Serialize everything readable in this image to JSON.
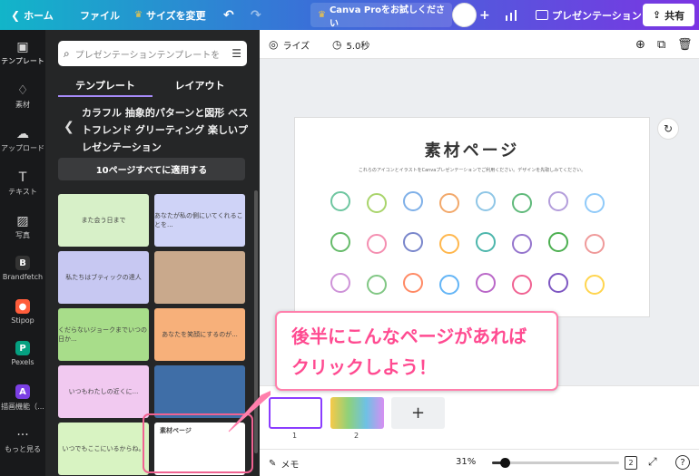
{
  "topbar": {
    "home_label": "ホーム",
    "file_label": "ファイル",
    "resize_label": "サイズを変更",
    "promo_label": "Canva Proをお試しください",
    "present_label": "プレゼンテーション",
    "share_label": "共有"
  },
  "rail": [
    {
      "label": "テンプレート",
      "icon": "layout-icon"
    },
    {
      "label": "素材",
      "icon": "elements-icon"
    },
    {
      "label": "アップロード",
      "icon": "cloud-upload-icon"
    },
    {
      "label": "テキスト",
      "icon": "text-icon"
    },
    {
      "label": "写真",
      "icon": "photo-icon"
    },
    {
      "label": "Brandfetch",
      "icon": "brandfetch-icon"
    },
    {
      "label": "Stipop",
      "icon": "stipop-icon"
    },
    {
      "label": "Pexels",
      "icon": "pexels-icon"
    },
    {
      "label": "描画機能（...",
      "icon": "draw-icon"
    },
    {
      "label": "もっと見る",
      "icon": "more-icon"
    }
  ],
  "panel": {
    "search_placeholder": "プレゼンテーションテンプレートを",
    "tabs": [
      "テンプレート",
      "レイアウト"
    ],
    "template_title": "カラフル 抽象的パターンと図形 ベストフレンド グリーティング 楽しいプレゼンテーション",
    "apply_all_label": "10ページすべてに適用する",
    "thumbnails": [
      {
        "text": "また会う日まで",
        "bg": "#d7f0c8"
      },
      {
        "text": "あなたが私の側にいてくれることを...",
        "bg": "#cfd3f7"
      },
      {
        "text": "私たちはブティックの達人",
        "bg": "#c7c8f2"
      },
      {
        "text": "",
        "bg": "#c9a98c"
      },
      {
        "text": "くだらないジョークまでいつの日か...",
        "bg": "#a8dd8a"
      },
      {
        "text": "あなたを笑顔にするのが...",
        "bg": "#f7b07a"
      },
      {
        "text": "いつもわたしの近くに...",
        "bg": "#f1c9f0"
      },
      {
        "text": "",
        "bg": "#3f6ea7"
      },
      {
        "text": "いつでもここにいるからね。",
        "bg": "#d8f3c2"
      },
      {
        "text": "素材ページ",
        "bg": "#ffffff"
      }
    ]
  },
  "editor": {
    "toolbar": {
      "animate_label": "ライズ",
      "duration_label": "5.0秒"
    },
    "slide": {
      "title": "素材ページ",
      "subtitle": "これらのアイコンとイラストをCanvaプレゼンテーションでご利用ください。デザインを先取しみてください。"
    },
    "pages": [
      {
        "number": "1"
      },
      {
        "number": "2"
      }
    ],
    "add_page_label": "+",
    "notes_label": "メモ",
    "zoom_label": "31%",
    "page_count": "2",
    "zoom_fraction": 0.1
  },
  "callout": {
    "line1": "後半にこんなページがあれば",
    "line2": "クリックしよう！"
  },
  "colors": {
    "accent": "#7b35e3",
    "callout_border": "#ff7fac",
    "callout_text": "#ff4b91"
  }
}
